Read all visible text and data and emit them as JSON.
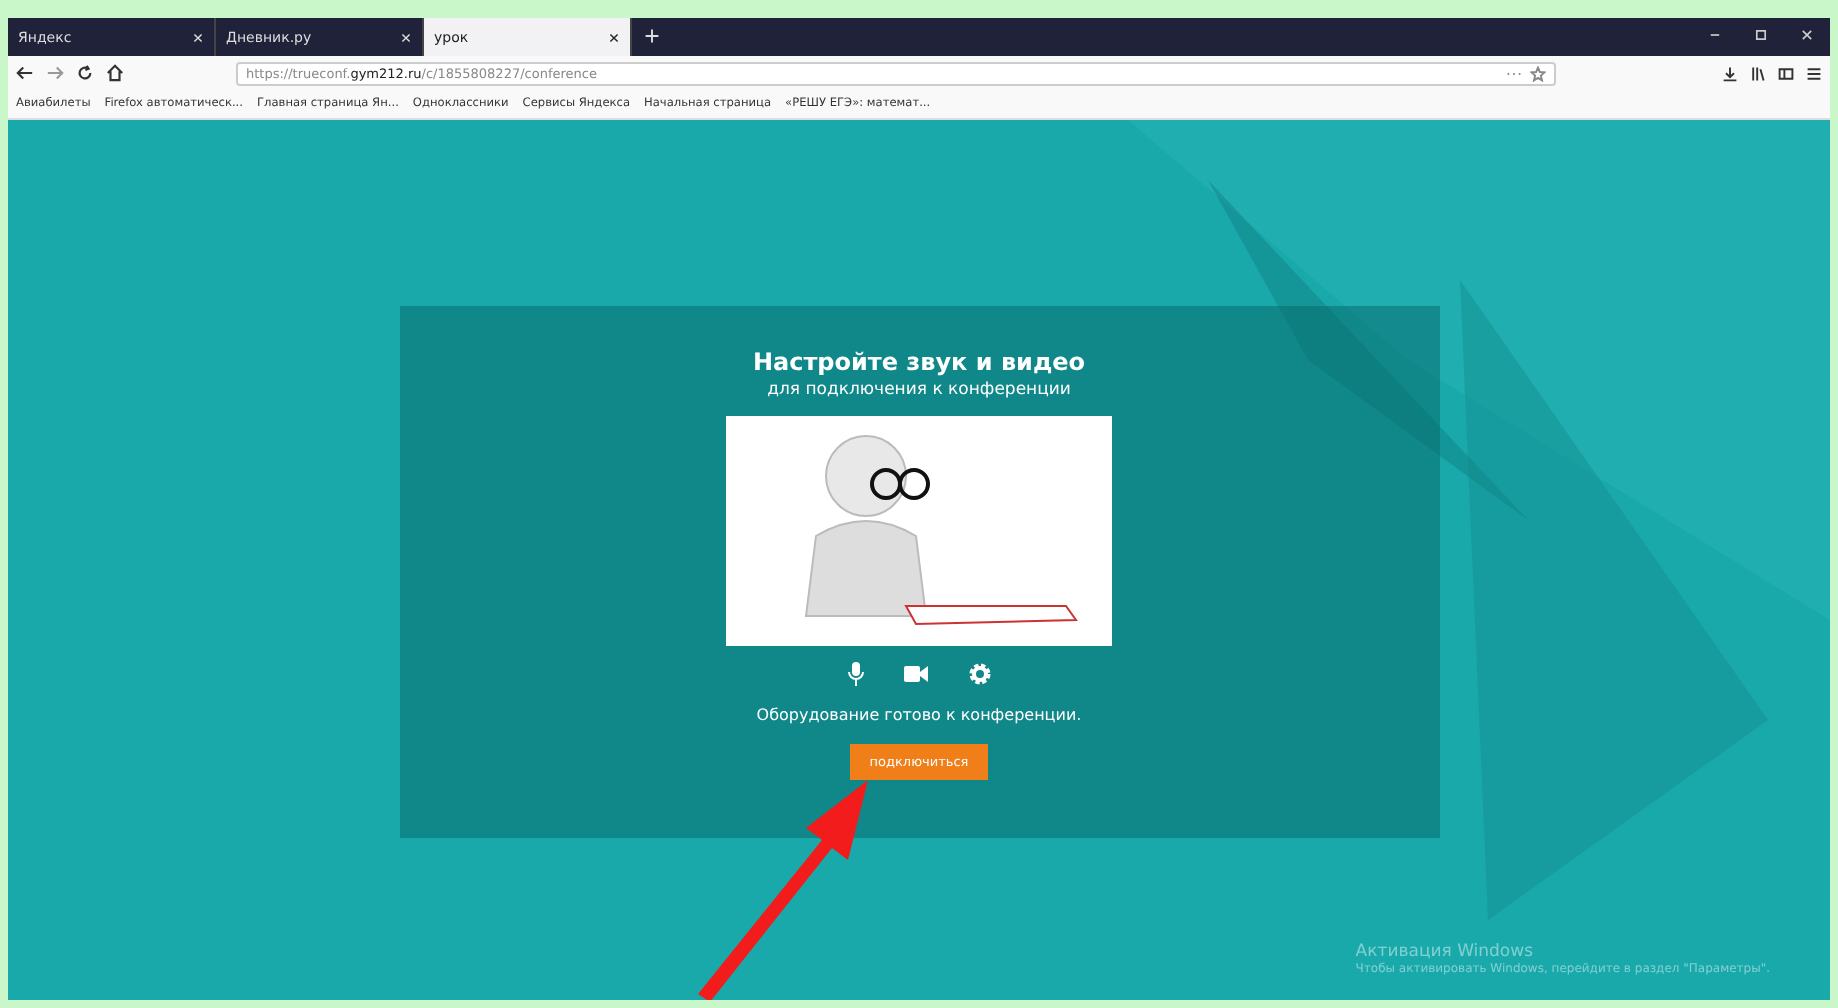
{
  "tabs": [
    {
      "title": "Яндекс",
      "selected": false
    },
    {
      "title": "Дневник.ру",
      "selected": false
    },
    {
      "title": "урок",
      "selected": true
    }
  ],
  "address": {
    "url_prefix": "https://trueconf.",
    "url_domain": "gym212.ru",
    "url_path": "/c/1855808227/conference"
  },
  "bookmarks": [
    "Авиабилеты",
    "Firefox автоматическ...",
    "Главная страница Ян...",
    "Одноклассники",
    "Сервисы Яндекса",
    "Начальная страница",
    "«РЕШУ ЕГЭ»: математ..."
  ],
  "dialog": {
    "title": "Настройте звук и видео",
    "subtitle": "для подключения к конференции",
    "status": "Оборудование готово к конференции.",
    "button": "подключиться"
  },
  "activation": {
    "title": "Активация Windows",
    "text": "Чтобы активировать Windows, перейдите в раздел \"Параметры\"."
  }
}
